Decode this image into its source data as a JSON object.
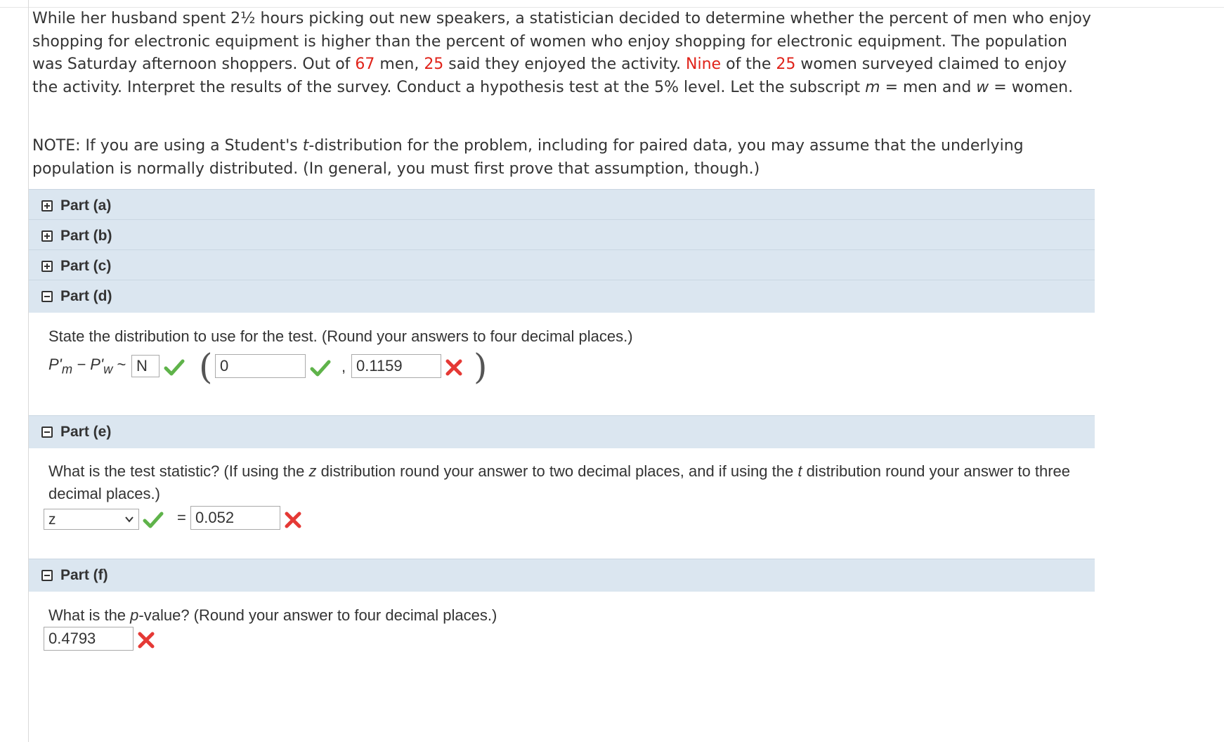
{
  "problem": {
    "stem": [
      {
        "t": "While her husband spent 2½ hours picking out new speakers, a statistician decided to determine whether the percent of men who enjoy shopping for electronic equipment is higher than the percent of women who enjoy shopping for electronic equipment. The population was Saturday afternoon shoppers. Out of ",
        "hl": false
      },
      {
        "t": "67",
        "hl": true
      },
      {
        "t": " men, ",
        "hl": false
      },
      {
        "t": "25",
        "hl": true
      },
      {
        "t": " said they enjoyed the activity. ",
        "hl": false
      },
      {
        "t": "Nine",
        "hl": true
      },
      {
        "t": " of the ",
        "hl": false
      },
      {
        "t": "25",
        "hl": true
      },
      {
        "t": " women surveyed claimed to enjoy the activity. Interpret the results of the survey. Conduct a hypothesis test at the 5% level. Let the subscript ",
        "hl": false
      },
      {
        "t": "m",
        "hl": false,
        "it": true
      },
      {
        "t": " = men and ",
        "hl": false
      },
      {
        "t": "w",
        "hl": false,
        "it": true
      },
      {
        "t": " = women.",
        "hl": false
      }
    ],
    "note_before": "NOTE: If you are using a Student's ",
    "note_t": "t",
    "note_after": "-distribution for the problem, including for paired data, you may assume that the underlying population is normally distributed. (In general, you must first prove that assumption, though.)"
  },
  "parts": {
    "a": {
      "label": "Part (a)",
      "state": "collapsed"
    },
    "b": {
      "label": "Part (b)",
      "state": "collapsed"
    },
    "c": {
      "label": "Part (c)",
      "state": "collapsed"
    },
    "d": {
      "label": "Part (d)",
      "state": "expanded",
      "question": "State the distribution to use for the test. (Round your answers to four decimal places.)",
      "lhs_p1": "P'",
      "lhs_sub1": "m",
      "lhs_mid": " − P'",
      "lhs_sub2": "w",
      "lhs_tilde": " ~",
      "dist_value": "N",
      "mean_value": "0",
      "comma": ",",
      "sd_value": "0.1159",
      "dist_status": "correct",
      "mean_status": "correct",
      "sd_status": "incorrect"
    },
    "e": {
      "label": "Part (e)",
      "state": "expanded",
      "question_1": "What is the test statistic? (If using the ",
      "question_z": "z",
      "question_2": " distribution round your answer to two decimal places, and if using the ",
      "question_t": "t",
      "question_3": " distribution round your answer to three decimal places.)",
      "select_value": "z",
      "equals": "=",
      "stat_value": "0.052",
      "select_status": "correct",
      "stat_status": "incorrect"
    },
    "f": {
      "label": "Part (f)",
      "state": "expanded",
      "question_1": "What is the ",
      "question_p": "p",
      "question_2": "-value? (Round your answer to four decimal places.)",
      "pvalue": "0.4793",
      "pvalue_status": "incorrect"
    }
  },
  "colors": {
    "highlight": "#e0231a",
    "part_header_bg": "#dbe6f0",
    "check_green": "#5fb34a",
    "cross_red": "#e53935"
  },
  "icons": {
    "collapsed": "plus-box-icon",
    "expanded": "minus-box-icon",
    "correct": "check-icon",
    "incorrect": "cross-icon"
  }
}
